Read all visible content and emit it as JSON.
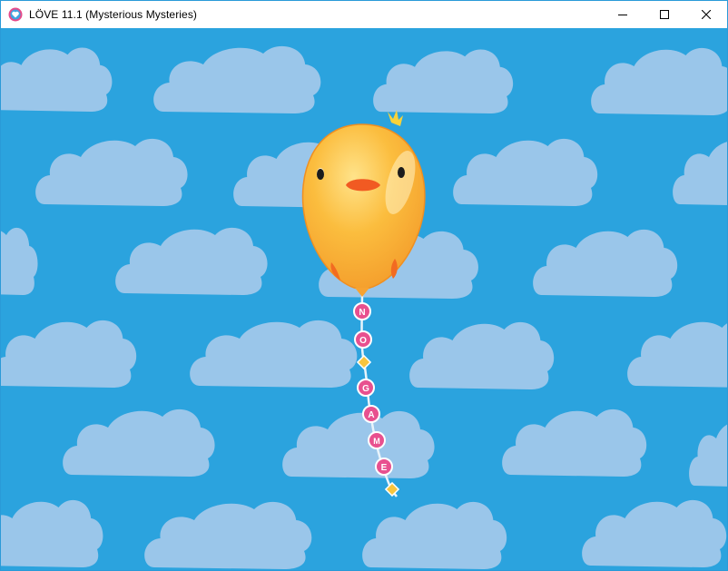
{
  "window": {
    "title": "LÖVE 11.1 (Mysterious Mysteries)",
    "icon": "love-heart-icon"
  },
  "controls": {
    "minimize_icon": "minimize-icon",
    "maximize_icon": "maximize-icon",
    "close_icon": "close-icon"
  },
  "scene": {
    "sky_color": "#2ba3de",
    "cloud_color": "#9ac6ea",
    "balloon_color": "#f8b43a",
    "tag_color": "#e8508f",
    "string_letters": [
      "N",
      "O",
      "G",
      "A",
      "M",
      "E"
    ]
  }
}
